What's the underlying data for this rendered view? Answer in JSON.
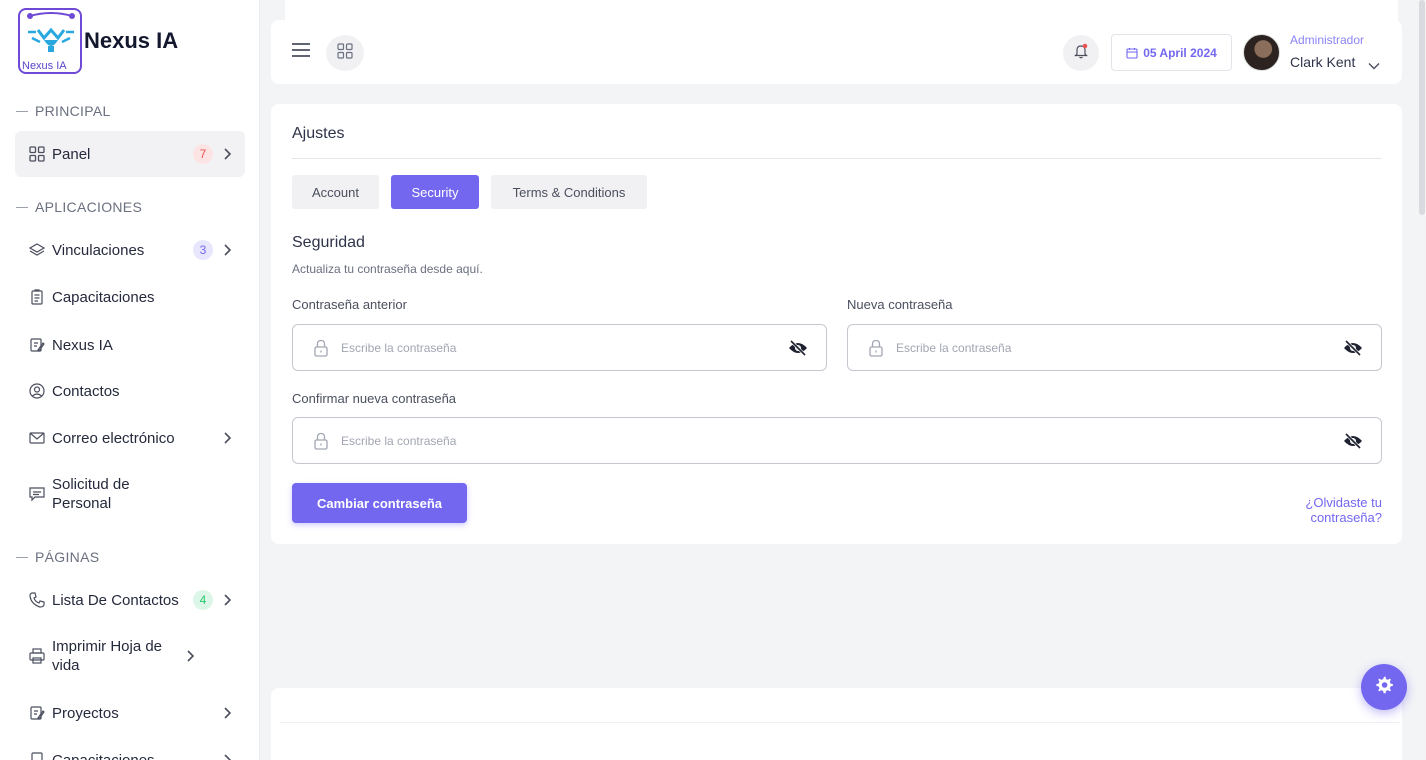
{
  "brand": {
    "name": "Nexus IA",
    "logo_caption": "Nexus IA"
  },
  "sidebar": {
    "sections": [
      {
        "label": "PRINCIPAL"
      },
      {
        "label": "APLICACIONES"
      },
      {
        "label": "PÁGINAS"
      }
    ],
    "items": [
      {
        "label": "Panel",
        "icon": "grid-icon",
        "badge": "7",
        "badge_color": "#ea5455",
        "has_chevron": true
      },
      {
        "label": "Vinculaciones",
        "icon": "layers-icon",
        "badge": "3",
        "badge_color": "#7367f0",
        "has_chevron": true
      },
      {
        "label": "Capacitaciones",
        "icon": "clipboard-icon",
        "has_chevron": false
      },
      {
        "label": "Nexus IA",
        "icon": "edit-icon",
        "has_chevron": false
      },
      {
        "label": "Contactos",
        "icon": "user-circle-icon",
        "has_chevron": false
      },
      {
        "label": "Correo electrónico",
        "icon": "mail-icon",
        "has_chevron": true
      },
      {
        "label": "Solicitud de Personal",
        "icon": "message-icon",
        "has_chevron": false
      },
      {
        "label": "Lista De Contactos",
        "icon": "phone-icon",
        "badge": "4",
        "badge_color": "#28c76f",
        "has_chevron": true
      },
      {
        "label": "Imprimir Hoja de vida",
        "icon": "printer-icon",
        "has_chevron": true
      },
      {
        "label": "Proyectos",
        "icon": "edit-icon",
        "has_chevron": true
      },
      {
        "label": "Capacitaciones",
        "icon": "file-icon",
        "has_chevron": true
      }
    ]
  },
  "header": {
    "date": "05 April 2024",
    "user_role": "Administrador",
    "user_name": "Clark Kent"
  },
  "settings": {
    "title": "Ajustes",
    "tabs": [
      {
        "label": "Account",
        "active": false
      },
      {
        "label": "Security",
        "active": true
      },
      {
        "label": "Terms & Conditions",
        "active": false
      }
    ],
    "section_title": "Seguridad",
    "section_subtitle": "Actualiza tu contraseña desde aquí.",
    "fields": [
      {
        "label": "Contraseña anterior",
        "placeholder": "Escribe la contraseña"
      },
      {
        "label": "Nueva contraseña",
        "placeholder": "Escribe la contraseña"
      },
      {
        "label": "Confirmar nueva contraseña",
        "placeholder": "Escribe la contraseña"
      }
    ],
    "submit_label": "Cambiar contraseña",
    "forgot_label": "¿Olvidaste tu contraseña?"
  },
  "colors": {
    "accent": "#7367f0",
    "brand": "#6f4ad6"
  }
}
